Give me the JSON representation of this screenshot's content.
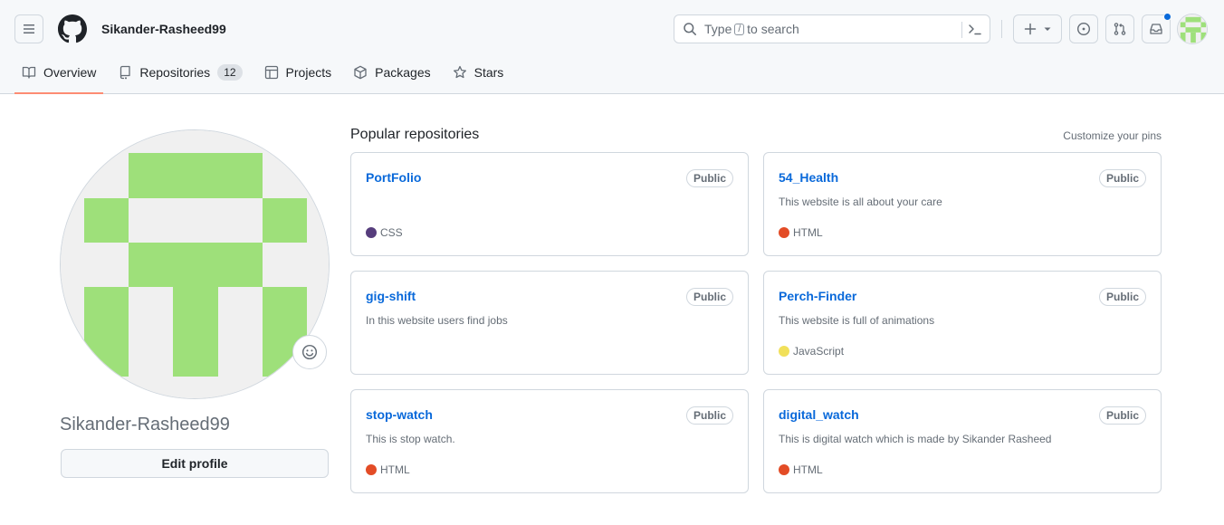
{
  "header": {
    "username": "Sikander-Rasheed99",
    "search": {
      "prefix": "Type",
      "key": "/",
      "suffix": "to search"
    }
  },
  "tabs": [
    {
      "label": "Overview",
      "icon": "book-icon"
    },
    {
      "label": "Repositories",
      "icon": "repo-icon",
      "count": "12"
    },
    {
      "label": "Projects",
      "icon": "table-icon"
    },
    {
      "label": "Packages",
      "icon": "package-icon"
    },
    {
      "label": "Stars",
      "icon": "star-icon"
    }
  ],
  "profile": {
    "name": "Sikander-Rasheed99",
    "edit_label": "Edit profile",
    "avatar_color": "#9ee07a"
  },
  "popular": {
    "title": "Popular repositories",
    "customize": "Customize your pins",
    "repos": [
      {
        "name": "PortFolio",
        "visibility": "Public",
        "description": "",
        "language": "CSS",
        "lang_color": "#563d7c"
      },
      {
        "name": "54_Health",
        "visibility": "Public",
        "description": "This website is all about your care",
        "language": "HTML",
        "lang_color": "#e34c26"
      },
      {
        "name": "gig-shift",
        "visibility": "Public",
        "description": "In this website users find jobs",
        "language": "",
        "lang_color": ""
      },
      {
        "name": "Perch-Finder",
        "visibility": "Public",
        "description": "This website is full of animations",
        "language": "JavaScript",
        "lang_color": "#f1e05a"
      },
      {
        "name": "stop-watch",
        "visibility": "Public",
        "description": "This is stop watch.",
        "language": "HTML",
        "lang_color": "#e34c26"
      },
      {
        "name": "digital_watch",
        "visibility": "Public",
        "description": "This is digital watch which is made by Sikander Rasheed",
        "language": "HTML",
        "lang_color": "#e34c26"
      }
    ]
  }
}
